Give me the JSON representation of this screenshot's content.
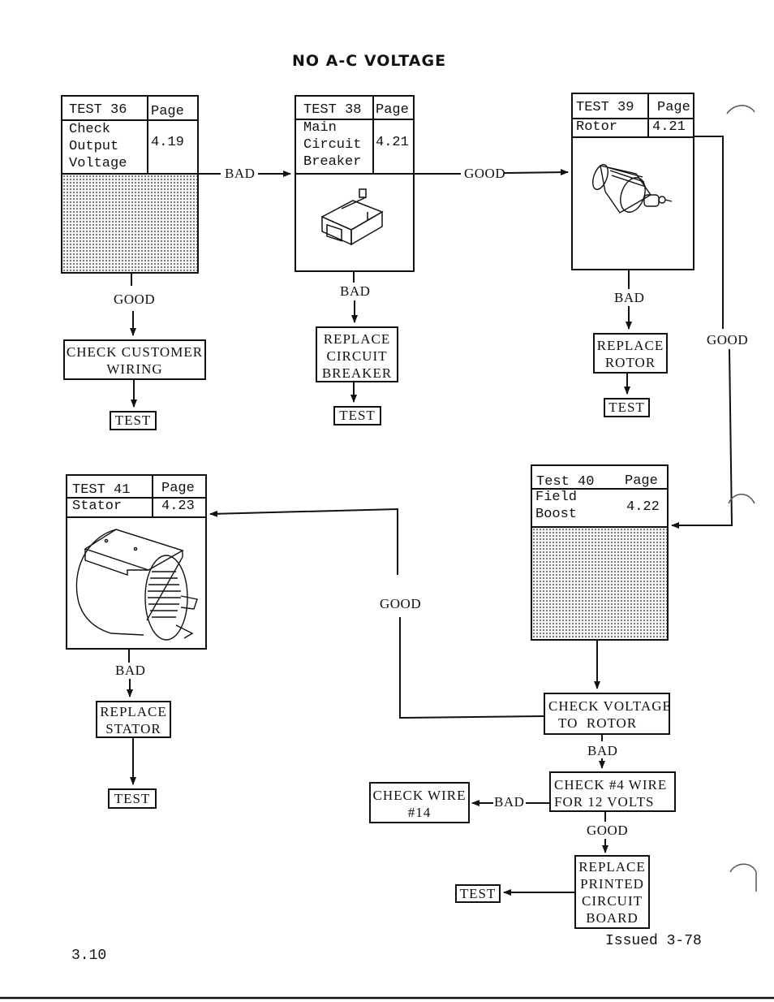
{
  "page": {
    "title": "NO A-C VOLTAGE",
    "page_number": "3.10",
    "issued": "Issued 3-78"
  },
  "tests": {
    "t36": {
      "test": "TEST 36",
      "page_label": "Page",
      "name_lines": [
        "Check",
        "Output",
        "Voltage"
      ],
      "page_ref": "4.19",
      "image": "none"
    },
    "t38": {
      "test": "TEST 38",
      "page_label": "Page",
      "name_lines": [
        "Main",
        "Circuit",
        "Breaker"
      ],
      "page_ref": "4.21",
      "image": "circuit-breaker-illustration"
    },
    "t39": {
      "test": "TEST 39",
      "page_label": "Page",
      "name_lines": [
        "Rotor"
      ],
      "page_ref": "4.21",
      "image": "rotor-illustration"
    },
    "t40": {
      "test": "Test 40",
      "page_label": "Page",
      "name_lines": [
        "Field",
        "Boost"
      ],
      "page_ref": "4.22",
      "image": "none"
    },
    "t41": {
      "test": "TEST 41",
      "page_label": "Page",
      "name_lines": [
        "Stator"
      ],
      "page_ref": "4.23",
      "image": "stator-illustration"
    }
  },
  "actions": {
    "check_customer_wiring": [
      "CHECK CUSTOMER",
      "WIRING"
    ],
    "replace_circuit_breaker": [
      "REPLACE",
      "CIRCUIT",
      "BREAKER"
    ],
    "replace_rotor": [
      "REPLACE",
      "ROTOR"
    ],
    "replace_stator": [
      "REPLACE",
      "STATOR"
    ],
    "check_voltage_to_rotor": [
      "CHECK VOLTAGE",
      "TO  ROTOR"
    ],
    "check_4_wire": [
      "CHECK #4 WIRE",
      "FOR 12 VOLTS"
    ],
    "check_wire_14": [
      "CHECK WIRE",
      "#14"
    ],
    "replace_pcb": [
      "REPLACE",
      "PRINTED",
      "CIRCUIT",
      "BOARD"
    ],
    "test": "TEST"
  },
  "edges": {
    "bad": "BAD",
    "good": "GOOD"
  },
  "flow": [
    {
      "from": "TEST 36",
      "to": "TEST 38",
      "label": "BAD"
    },
    {
      "from": "TEST 36",
      "to": "CHECK CUSTOMER WIRING",
      "label": "GOOD"
    },
    {
      "from": "CHECK CUSTOMER WIRING",
      "to": "TEST",
      "label": ""
    },
    {
      "from": "TEST 38",
      "to": "TEST 39",
      "label": "GOOD"
    },
    {
      "from": "TEST 38",
      "to": "REPLACE CIRCUIT BREAKER",
      "label": "BAD"
    },
    {
      "from": "REPLACE CIRCUIT BREAKER",
      "to": "TEST",
      "label": ""
    },
    {
      "from": "TEST 39",
      "to": "REPLACE ROTOR",
      "label": "BAD"
    },
    {
      "from": "REPLACE ROTOR",
      "to": "TEST",
      "label": ""
    },
    {
      "from": "TEST 39",
      "to": "Test 40",
      "label": "GOOD"
    },
    {
      "from": "Test 40",
      "to": "CHECK VOLTAGE TO ROTOR",
      "label": ""
    },
    {
      "from": "CHECK VOLTAGE TO ROTOR",
      "to": "TEST 41",
      "label": "GOOD"
    },
    {
      "from": "CHECK VOLTAGE TO ROTOR",
      "to": "CHECK #4 WIRE FOR 12 VOLTS",
      "label": "BAD"
    },
    {
      "from": "CHECK #4 WIRE FOR 12 VOLTS",
      "to": "CHECK WIRE #14",
      "label": "BAD"
    },
    {
      "from": "CHECK #4 WIRE FOR 12 VOLTS",
      "to": "REPLACE PRINTED CIRCUIT BOARD",
      "label": "GOOD"
    },
    {
      "from": "REPLACE PRINTED CIRCUIT BOARD",
      "to": "TEST",
      "label": ""
    },
    {
      "from": "TEST 41",
      "to": "REPLACE STATOR",
      "label": "BAD"
    },
    {
      "from": "REPLACE STATOR",
      "to": "TEST",
      "label": ""
    }
  ]
}
